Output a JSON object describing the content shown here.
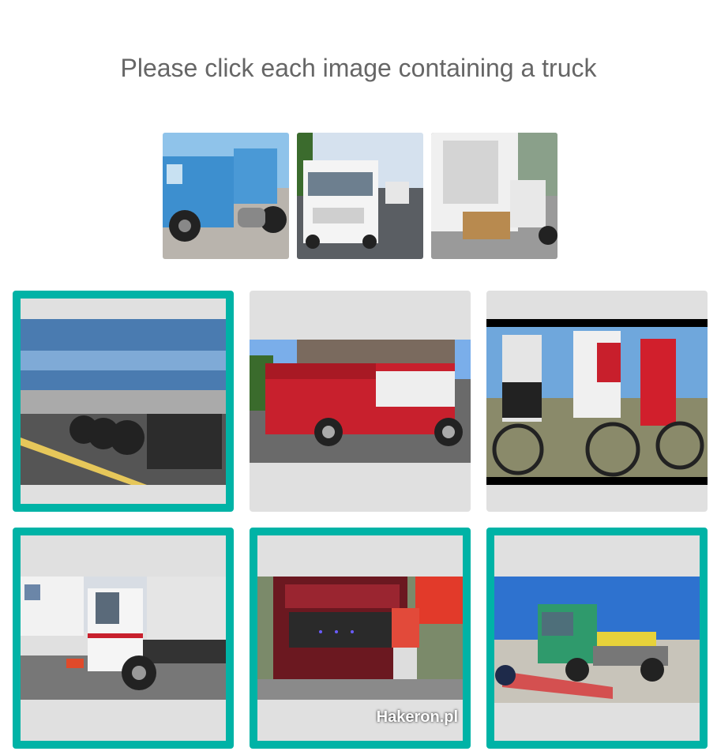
{
  "prompt": "Please click each image containing a truck",
  "examples": [
    {
      "name": "example-blue-truck"
    },
    {
      "name": "example-white-truck"
    },
    {
      "name": "example-cargo-truck"
    }
  ],
  "grid": [
    {
      "selected": true
    },
    {
      "selected": false
    },
    {
      "selected": false
    },
    {
      "selected": true
    },
    {
      "selected": true,
      "watermark": "Hakeron.pl"
    },
    {
      "selected": true
    }
  ],
  "colors": {
    "selection_border": "#00b3a6",
    "tile_bg": "#e0e0e0",
    "prompt_text": "#666666"
  }
}
